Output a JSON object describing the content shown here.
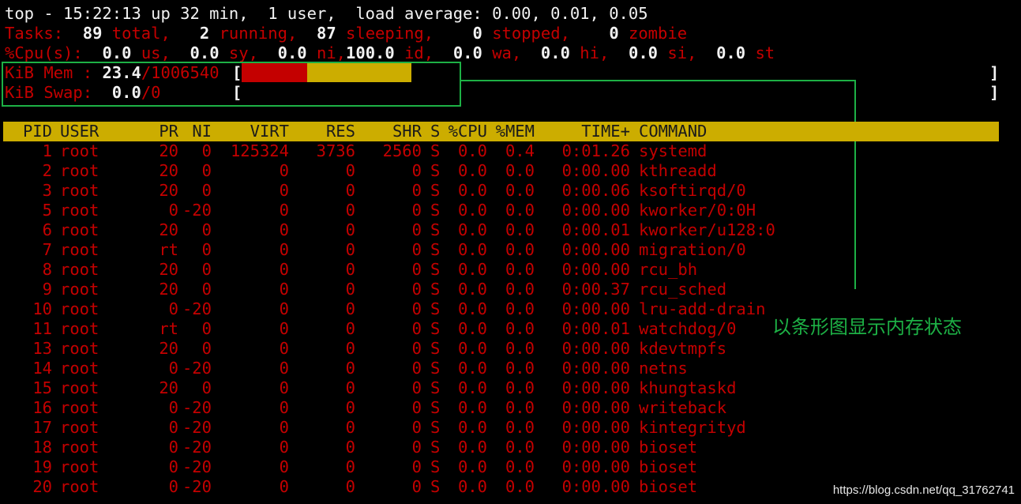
{
  "summary": {
    "l1": "top - 15:22:13 up 32 min,  1 user,  load average: 0.00, 0.01, 0.05",
    "tasks": {
      "label": "Tasks:",
      "total": "89",
      "total_l": "total,",
      "running": "2",
      "running_l": "running,",
      "sleeping": "87",
      "sleeping_l": "sleeping,",
      "stopped": "0",
      "stopped_l": "stopped,",
      "zombie": "0",
      "zombie_l": "zombie"
    },
    "cpu": {
      "label": "%Cpu(s):",
      "us": "0.0",
      "us_l": "us,",
      "sy": "0.0",
      "sy_l": "sy,",
      "ni": "0.0",
      "ni_l": "ni,",
      "id": "100.0",
      "id_l": "id,",
      "wa": "0.0",
      "wa_l": "wa,",
      "hi": "0.0",
      "hi_l": "hi,",
      "si": "0.0",
      "si_l": "si,",
      "st": "0.0",
      "st_l": "st"
    },
    "mem": {
      "label": "KiB Mem :",
      "used": "23.4",
      "total": "/1006540",
      "open": "[",
      "close": "]",
      "bar_used_pct": 8.3,
      "bar_buffer_pct": 13.2
    },
    "swap": {
      "label": "KiB Swap:",
      "used": "0.0",
      "total": "/0",
      "open": "[",
      "close": "]"
    }
  },
  "columns": [
    "PID",
    "USER",
    "PR",
    "NI",
    "VIRT",
    "RES",
    "SHR",
    "S",
    "%CPU",
    "%MEM",
    "TIME+",
    "COMMAND"
  ],
  "processes": [
    [
      "1",
      "root",
      "20",
      "0",
      "125324",
      "3736",
      "2560",
      "S",
      "0.0",
      "0.4",
      "0:01.26",
      "systemd"
    ],
    [
      "2",
      "root",
      "20",
      "0",
      "0",
      "0",
      "0",
      "S",
      "0.0",
      "0.0",
      "0:00.00",
      "kthreadd"
    ],
    [
      "3",
      "root",
      "20",
      "0",
      "0",
      "0",
      "0",
      "S",
      "0.0",
      "0.0",
      "0:00.06",
      "ksoftirqd/0"
    ],
    [
      "5",
      "root",
      "0",
      "-20",
      "0",
      "0",
      "0",
      "S",
      "0.0",
      "0.0",
      "0:00.00",
      "kworker/0:0H"
    ],
    [
      "6",
      "root",
      "20",
      "0",
      "0",
      "0",
      "0",
      "S",
      "0.0",
      "0.0",
      "0:00.01",
      "kworker/u128:0"
    ],
    [
      "7",
      "root",
      "rt",
      "0",
      "0",
      "0",
      "0",
      "S",
      "0.0",
      "0.0",
      "0:00.00",
      "migration/0"
    ],
    [
      "8",
      "root",
      "20",
      "0",
      "0",
      "0",
      "0",
      "S",
      "0.0",
      "0.0",
      "0:00.00",
      "rcu_bh"
    ],
    [
      "9",
      "root",
      "20",
      "0",
      "0",
      "0",
      "0",
      "S",
      "0.0",
      "0.0",
      "0:00.37",
      "rcu_sched"
    ],
    [
      "10",
      "root",
      "0",
      "-20",
      "0",
      "0",
      "0",
      "S",
      "0.0",
      "0.0",
      "0:00.00",
      "lru-add-drain"
    ],
    [
      "11",
      "root",
      "rt",
      "0",
      "0",
      "0",
      "0",
      "S",
      "0.0",
      "0.0",
      "0:00.01",
      "watchdog/0"
    ],
    [
      "13",
      "root",
      "20",
      "0",
      "0",
      "0",
      "0",
      "S",
      "0.0",
      "0.0",
      "0:00.00",
      "kdevtmpfs"
    ],
    [
      "14",
      "root",
      "0",
      "-20",
      "0",
      "0",
      "0",
      "S",
      "0.0",
      "0.0",
      "0:00.00",
      "netns"
    ],
    [
      "15",
      "root",
      "20",
      "0",
      "0",
      "0",
      "0",
      "S",
      "0.0",
      "0.0",
      "0:00.00",
      "khungtaskd"
    ],
    [
      "16",
      "root",
      "0",
      "-20",
      "0",
      "0",
      "0",
      "S",
      "0.0",
      "0.0",
      "0:00.00",
      "writeback"
    ],
    [
      "17",
      "root",
      "0",
      "-20",
      "0",
      "0",
      "0",
      "S",
      "0.0",
      "0.0",
      "0:00.00",
      "kintegrityd"
    ],
    [
      "18",
      "root",
      "0",
      "-20",
      "0",
      "0",
      "0",
      "S",
      "0.0",
      "0.0",
      "0:00.00",
      "bioset"
    ],
    [
      "19",
      "root",
      "0",
      "-20",
      "0",
      "0",
      "0",
      "S",
      "0.0",
      "0.0",
      "0:00.00",
      "bioset"
    ],
    [
      "20",
      "root",
      "0",
      "-20",
      "0",
      "0",
      "0",
      "S",
      "0.0",
      "0.0",
      "0:00.00",
      "bioset"
    ]
  ],
  "annotation": "以条形图显示内存状态",
  "watermark": "https://blog.csdn.net/qq_31762741",
  "colors": {
    "red": "#c40000",
    "yellow": "#ccad00",
    "green": "#1db045",
    "white": "#f2f2f2"
  }
}
